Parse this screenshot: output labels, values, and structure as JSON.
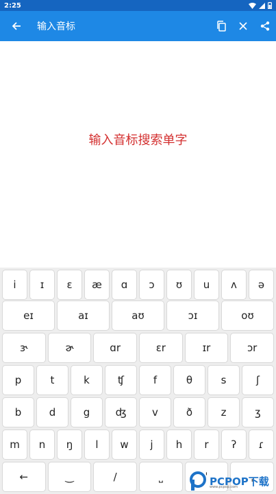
{
  "status_bar": {
    "time": "2:25"
  },
  "app_bar": {
    "title": "输入音标",
    "back_icon": "arrow-left-icon",
    "actions": [
      "copy-icon",
      "close-icon",
      "share-icon"
    ]
  },
  "content": {
    "hint": "输入音标搜索单字"
  },
  "keyboard": {
    "row1": [
      "i",
      "ɪ",
      "ɛ",
      "æ",
      "ɑ",
      "ɔ",
      "ʊ",
      "u",
      "ʌ",
      "ə"
    ],
    "row2": [
      "eɪ",
      "aɪ",
      "aʊ",
      "ɔɪ",
      "oʊ"
    ],
    "row3": [
      "ɝ",
      "ɚ",
      "ɑr",
      "ɛr",
      "ɪr",
      "ɔr"
    ],
    "row4": [
      "p",
      "t",
      "k",
      "ʧ",
      "f",
      "θ",
      "s",
      "ʃ"
    ],
    "row5": [
      "b",
      "d",
      "g",
      "ʤ",
      "v",
      "ð",
      "z",
      "ʒ"
    ],
    "row6": [
      "m",
      "n",
      "ŋ",
      "l",
      "w",
      "j",
      "h",
      "r",
      "ʔ",
      "ɾ"
    ],
    "row7": [
      "←",
      "‿",
      "/",
      "⎵",
      "ˈ",
      "ˌ"
    ]
  },
  "watermark": {
    "text": "PCPOP下载",
    "sub": "www.pcpop.com"
  }
}
